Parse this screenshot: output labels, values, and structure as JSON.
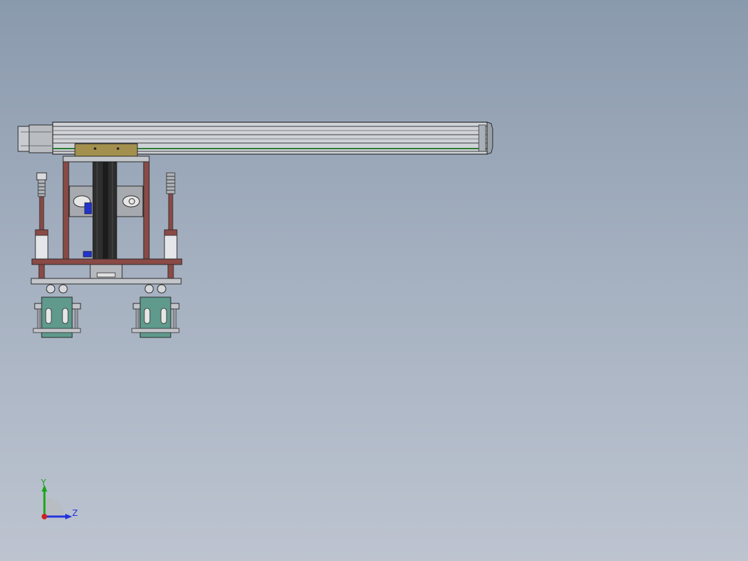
{
  "viewport": {
    "background_top": "#8a9aad",
    "background_bottom": "#bdc4d0"
  },
  "model": {
    "colors": {
      "rail": "#c9cdd2",
      "rail_edge": "#2a2a2a",
      "carriage": "#a3904e",
      "frame": "#8a4a46",
      "column": "#2e2e2e",
      "plate": "#b5b8bd",
      "gripper": "#5f9a8c",
      "accent_blue": "#2233cc",
      "accent_green": "#2e7d32"
    }
  },
  "triad": {
    "y_label": "Y",
    "z_label": "Z",
    "y_color": "#1aa51a",
    "z_color": "#2233dd",
    "x_color": "#cc2222"
  }
}
